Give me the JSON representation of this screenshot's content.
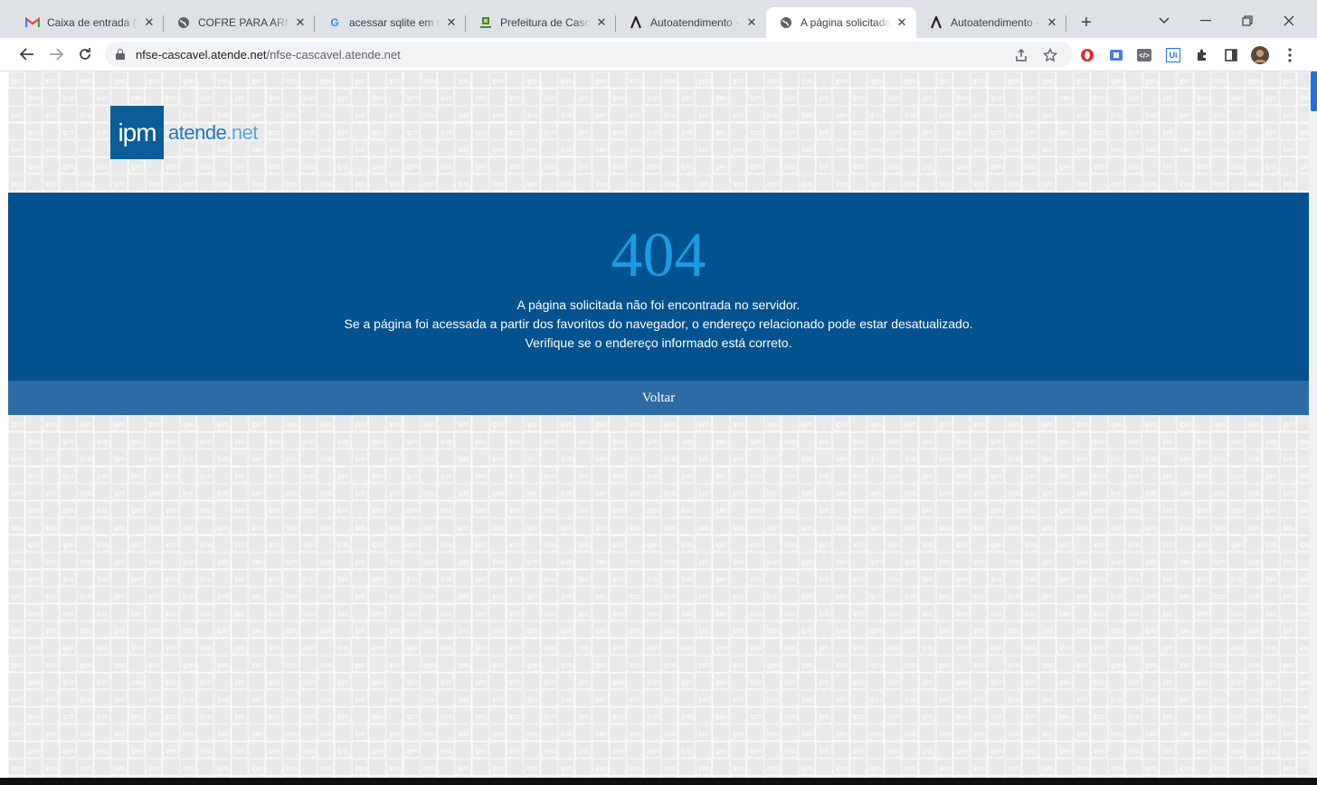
{
  "tabs": [
    {
      "title": "Caixa de entrada (5",
      "icon": "gmail-icon"
    },
    {
      "title": "COFRE PARA ARMA",
      "icon": "globe-icon"
    },
    {
      "title": "acessar sqlite em n",
      "icon": "google-icon"
    },
    {
      "title": "Prefeitura de Casca",
      "icon": "city-crest-icon"
    },
    {
      "title": "Autoatendimento -",
      "icon": "atende-logo-icon"
    },
    {
      "title": "A página solicitada",
      "icon": "globe-icon",
      "active": true
    },
    {
      "title": "Autoatendimento -",
      "icon": "atende-logo-icon"
    }
  ],
  "address_bar": {
    "domain": "nfse-cascavel.atende.net",
    "path": "/nfse-cascavel.atende.net"
  },
  "brand": {
    "box_text": "ipm",
    "name": "atende",
    "suffix": ".net"
  },
  "error": {
    "code": "404",
    "line1": "A página solicitada não foi encontrada no servidor.",
    "line2": "Se a página foi acessada a partir dos favoritos do navegador, o endereço relacionado pode estar desatualizado.",
    "line3": "Verifique se o endereço informado está correto.",
    "back_label": "Voltar"
  },
  "pattern_text": "ipm",
  "extensions": {
    "ext2": "",
    "ext3": "</>",
    "ext4": "Ui"
  },
  "colors": {
    "panel": "#02528f",
    "code": "#1b9be4",
    "back_bar": "#2d6ba4",
    "background": "#e9e9e9"
  }
}
